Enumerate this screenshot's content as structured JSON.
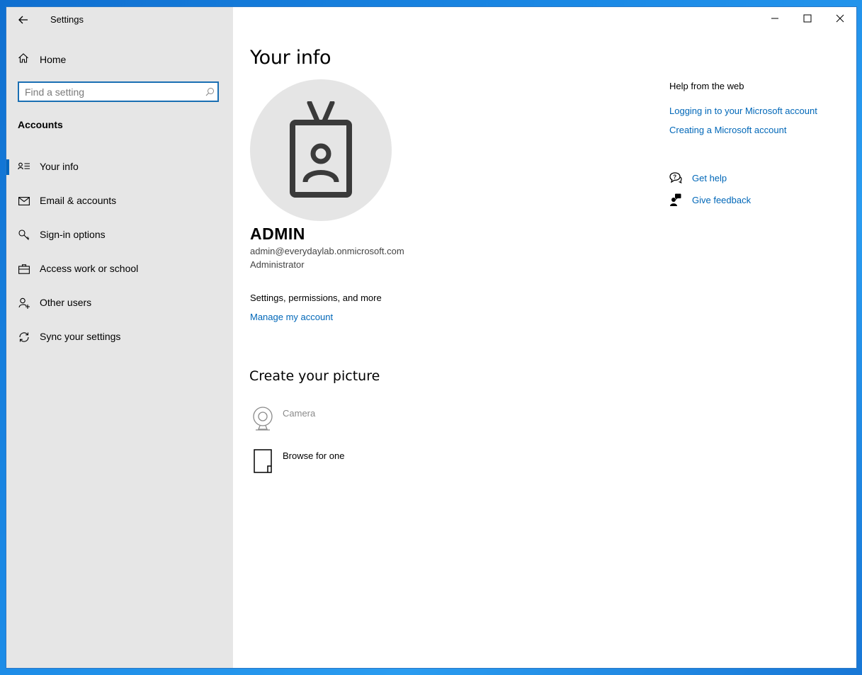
{
  "window": {
    "title": "Settings"
  },
  "sidebar": {
    "home_label": "Home",
    "search_placeholder": "Find a setting",
    "section_title": "Accounts",
    "items": [
      {
        "label": "Your info",
        "icon": "contact-info-icon",
        "active": true
      },
      {
        "label": "Email & accounts",
        "icon": "mail-icon",
        "active": false
      },
      {
        "label": "Sign-in options",
        "icon": "key-icon",
        "active": false
      },
      {
        "label": "Access work or school",
        "icon": "briefcase-icon",
        "active": false
      },
      {
        "label": "Other users",
        "icon": "add-person-icon",
        "active": false
      },
      {
        "label": "Sync your settings",
        "icon": "sync-icon",
        "active": false
      }
    ]
  },
  "main": {
    "title": "Your info",
    "user": {
      "name": "ADMIN",
      "email": "admin@everydaylab.onmicrosoft.com",
      "role": "Administrator"
    },
    "permissions_text": "Settings, permissions, and more",
    "manage_link": "Manage my account",
    "create_picture_title": "Create your picture",
    "picture_options": {
      "camera": "Camera",
      "browse": "Browse for one"
    }
  },
  "help": {
    "title": "Help from the web",
    "links": [
      "Logging in to your Microsoft account",
      "Creating a Microsoft account"
    ],
    "get_help": "Get help",
    "give_feedback": "Give feedback"
  },
  "colors": {
    "accent": "#0067c0",
    "link": "#0067b8",
    "sidebar_bg": "#e6e6e6",
    "desktop": "#1a7fd4"
  }
}
